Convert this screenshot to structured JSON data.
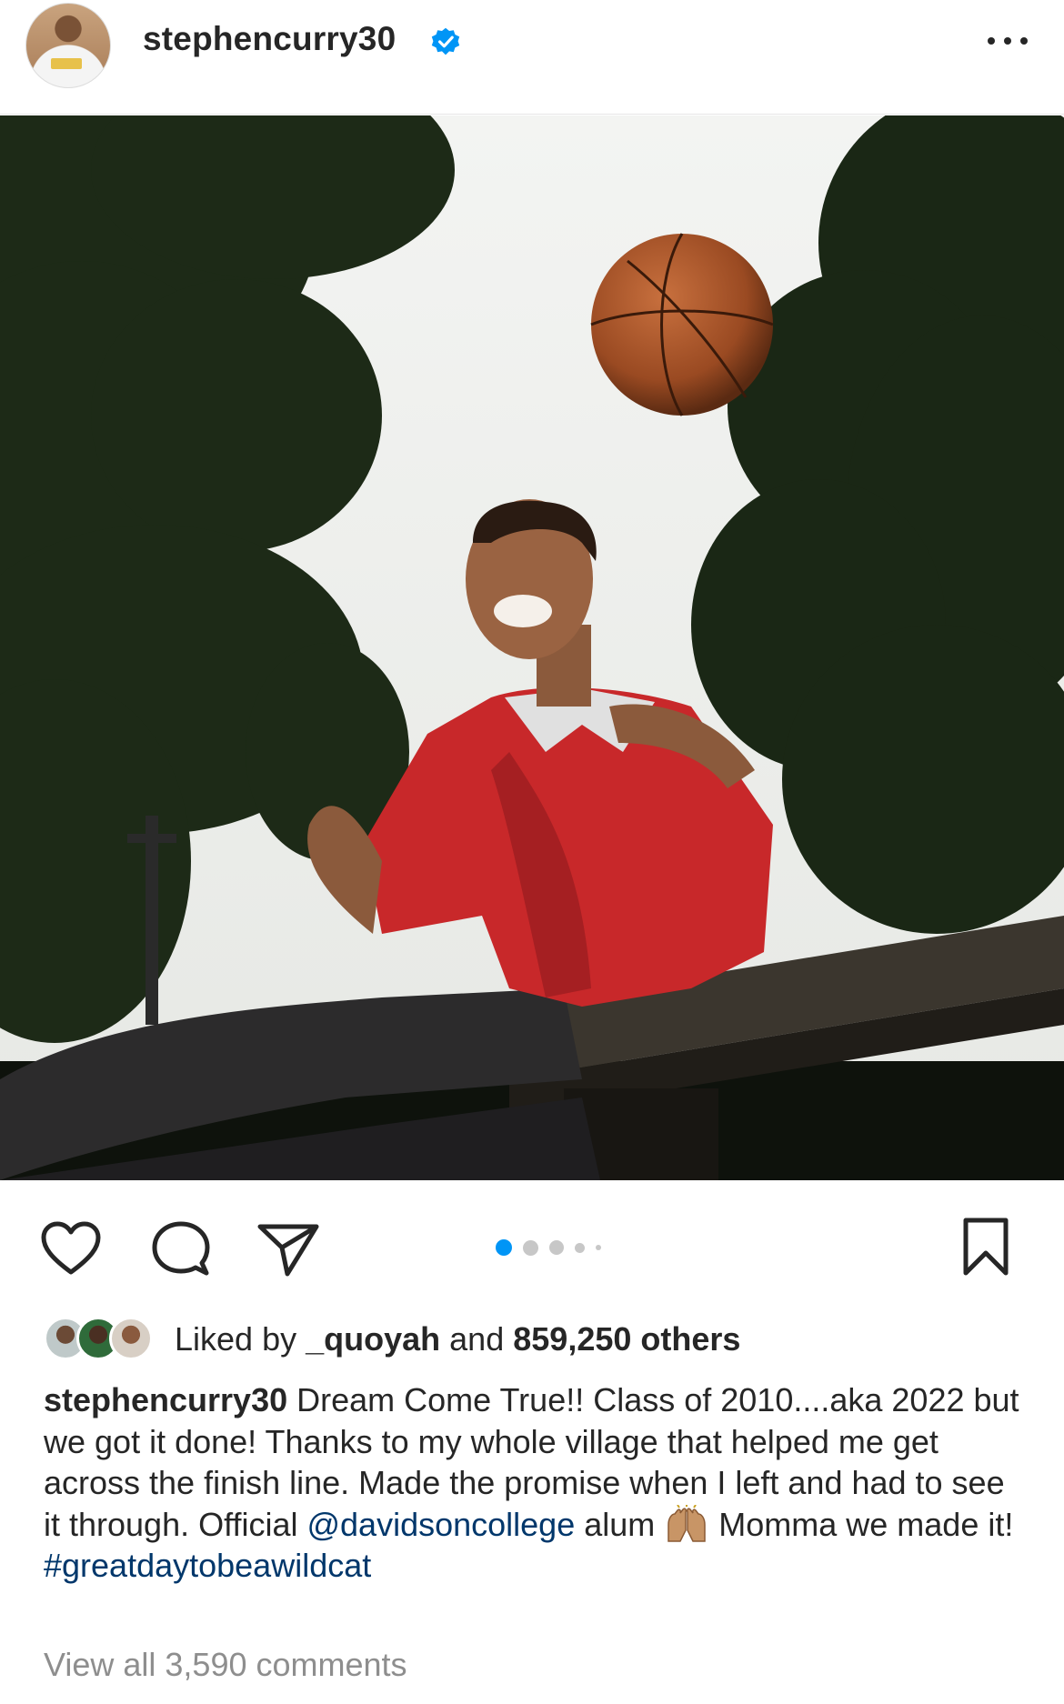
{
  "post": {
    "username": "stephencurry30",
    "verified_icon": "verified-badge-icon",
    "more_icon": "more-options-icon",
    "carousel": {
      "total": 5,
      "active_index": 0
    },
    "likes": {
      "prefix": "Liked by",
      "first_liker": "_quoyah",
      "middle": "and",
      "count_text": "859,250 others"
    },
    "caption": {
      "username": "stephencurry30",
      "text_before_mention": " Dream Come True!! Class of 2010....aka 2022 but we got it done! Thanks to my whole village that helped me get across the finish line. Made the promise when I left and had to see it through. Official ",
      "mention": "@davidsoncollege",
      "text_after_mention": " alum ",
      "emoji": "raising-hands-emoji",
      "text_after_emoji": " Momma we made it!",
      "hashtag": "#greatdaytobeawildcat"
    },
    "view_comments": "View all 3,590 comments",
    "colors": {
      "accent": "#0095f6",
      "link": "#00376b",
      "muted": "#8e8e8e",
      "text": "#262626"
    }
  }
}
